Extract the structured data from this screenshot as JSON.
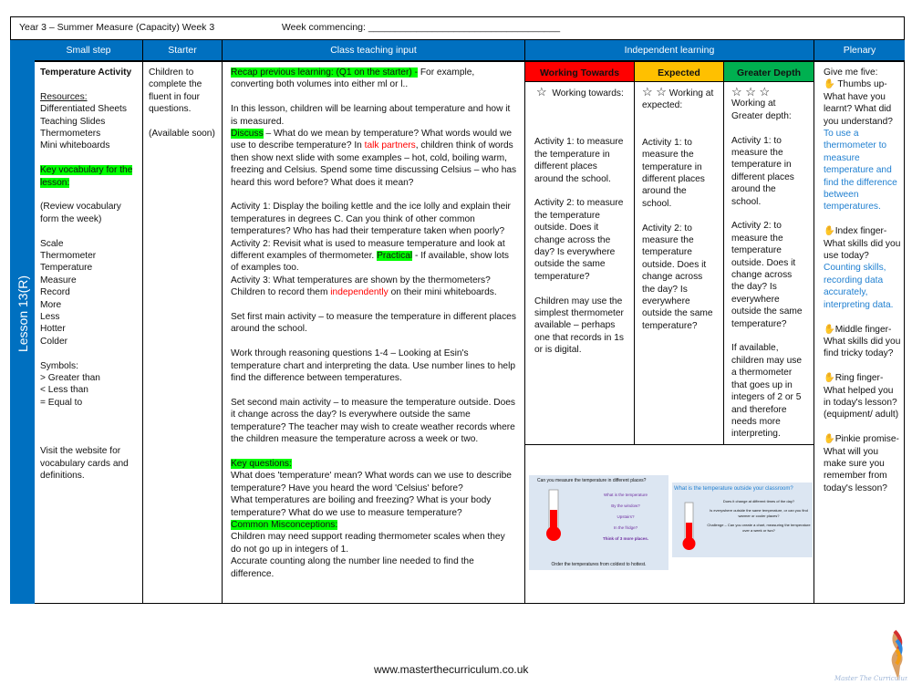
{
  "header": {
    "title": "Year 3 – Summer Measure (Capacity)  Week 3",
    "week_commencing": "Week commencing: ____________________________________"
  },
  "columns": {
    "small_step": "Small step",
    "starter": "Starter",
    "class_teaching": "Class teaching input",
    "independent": "Independent learning",
    "plenary": "Plenary"
  },
  "lesson_label": "Lesson 13(R)",
  "small_step": {
    "title": "Temperature Activity",
    "resources_label": "Resources:",
    "resources": [
      "Differentiated Sheets",
      "Teaching Slides",
      "Thermometers",
      "Mini whiteboards"
    ],
    "vocab_label": "Key vocabulary for the lesson:",
    "vocab_note": "(Review vocabulary form the week)",
    "vocab": [
      "Scale",
      "Thermometer",
      "Temperature",
      "Measure",
      "Record",
      "More",
      "Less",
      "Hotter",
      "Colder"
    ],
    "symbols_label": "Symbols:",
    "symbols": [
      "> Greater than",
      "< Less than",
      "= Equal to"
    ],
    "website_note": "Visit the website for vocabulary cards and definitions."
  },
  "starter": {
    "text": "Children to complete the fluent in four questions.",
    "note": "(Available soon)"
  },
  "teaching": {
    "recap_hl": "Recap previous learning: (Q1 on the starter) -",
    "recap_rest": " For example, converting both volumes into either ml or l..",
    "intro": "In this lesson, children will be learning about temperature and how it is measured.",
    "discuss_hl": "Discuss",
    "discuss_a": " – What do we mean by temperature? What words would we use to describe temperature? In ",
    "discuss_red": "talk partners",
    "discuss_b": ", children think of words then show next slide with some examples – hot, cold, boiling warm, freezing and Celsius. Spend some time discussing Celsius – who has heard this word before? What does it mean?",
    "act1": "Activity 1: Display the boiling kettle and the ice lolly and explain their temperatures in degrees C. Can you think of other common temperatures? Who has had their temperature taken when poorly?",
    "act2_a": "Activity 2: Revisit what is used to measure temperature and look at different examples of thermometer. ",
    "act2_hl": "Practical",
    "act2_b": " - If available, show lots of examples too.",
    "act3_a": "Activity 3: What temperatures are shown by the thermometers? Children to record them ",
    "act3_red": "independently",
    "act3_b": " on their mini whiteboards.",
    "main1": "Set first main activity – to measure the temperature in different places around the school.",
    "reasoning": "Work through reasoning questions 1-4 – Looking at Esin's temperature chart and interpreting the data. Use number lines to help find the difference between temperatures.",
    "main2": "Set second main activity – to measure the temperature outside. Does it change across the day? Is everywhere outside the same temperature? The teacher may wish to create weather records where the children measure the temperature across a week or two.",
    "kq_label": "Key questions:",
    "kq": "What does 'temperature' mean? What words can we use to describe temperature? Have you heard the word 'Celsius' before?",
    "kq2": "What temperatures are boiling and freezing? What is your body temperature? What do we use to measure temperature?",
    "mis_label": "Common Misconceptions:",
    "mis1": "Children may need support reading thermometer scales when they do not go up in integers of 1.",
    "mis2": "Accurate counting along the number line needed to find the difference."
  },
  "independent": {
    "wt": {
      "label": "Working Towards",
      "color": "#ff0000",
      "stars": "☆",
      "heading": "Working towards:",
      "a1": "Activity 1:  to measure the temperature in different places around the school.",
      "a2": "Activity 2: to measure the temperature outside. Does it change across the day? Is everywhere outside the same temperature?",
      "note": "Children may use the simplest thermometer available – perhaps one that records in 1s or is digital."
    },
    "ex": {
      "label": "Expected",
      "color": "#ffc000",
      "stars": "☆ ☆",
      "heading": "Working at expected:",
      "a1": "Activity 1:  to measure the temperature in different places around the school.",
      "a2": "Activity 2: to measure the temperature outside. Does it change across the day? Is everywhere outside the same temperature?"
    },
    "gd": {
      "label": "Greater Depth",
      "color": "#00b050",
      "stars": "☆ ☆ ☆",
      "heading": "Working at Greater depth:",
      "a1": "Activity 1:  to measure the temperature in different places around the school.",
      "a2": "Activity 2: to measure the temperature outside. Does it change across the day? Is everywhere outside the same temperature?",
      "note": "If available, children may use a thermometer that goes up in integers of 2 or 5 and therefore needs more interpreting."
    },
    "slide1": {
      "title": "Can you measure the temperature in different places?",
      "q": [
        "What is the temperature",
        "By the window?",
        "Upstairs?",
        "In the fridge?",
        "Think of 3 more places."
      ],
      "footer": "Order the temperatures from coldest to hottest."
    },
    "slide2": {
      "title": "What is the temperature outside your classroom?",
      "q": [
        "Does it change at different times of the day?",
        "Is everywhere outside the same temperature, or can you find warmer or cooler places?",
        "Challenge – Can you create a chart, measuring the temperature over a week or two?"
      ]
    }
  },
  "plenary": {
    "intro": "Give me five:",
    "items": [
      {
        "q": " Thumbs up- What have you learnt? What did you understand?",
        "a": "To use a thermometer to measure temperature and find the difference between temperatures."
      },
      {
        "q": "Index finger- What skills did you use today?",
        "a": "Counting skills, recording data accurately, interpreting data."
      },
      {
        "q": "Middle finger- What skills did you find tricky today?"
      },
      {
        "q": "Ring finger- What helped you in today's lesson? (equipment/ adult)"
      },
      {
        "q": "Pinkie promise- What will you make sure you remember from today's lesson?"
      }
    ],
    "icon": "hand-icon"
  },
  "footer": {
    "website": "www.masterthecurriculum.co.uk",
    "logo_text": "Master The Curriculum"
  }
}
